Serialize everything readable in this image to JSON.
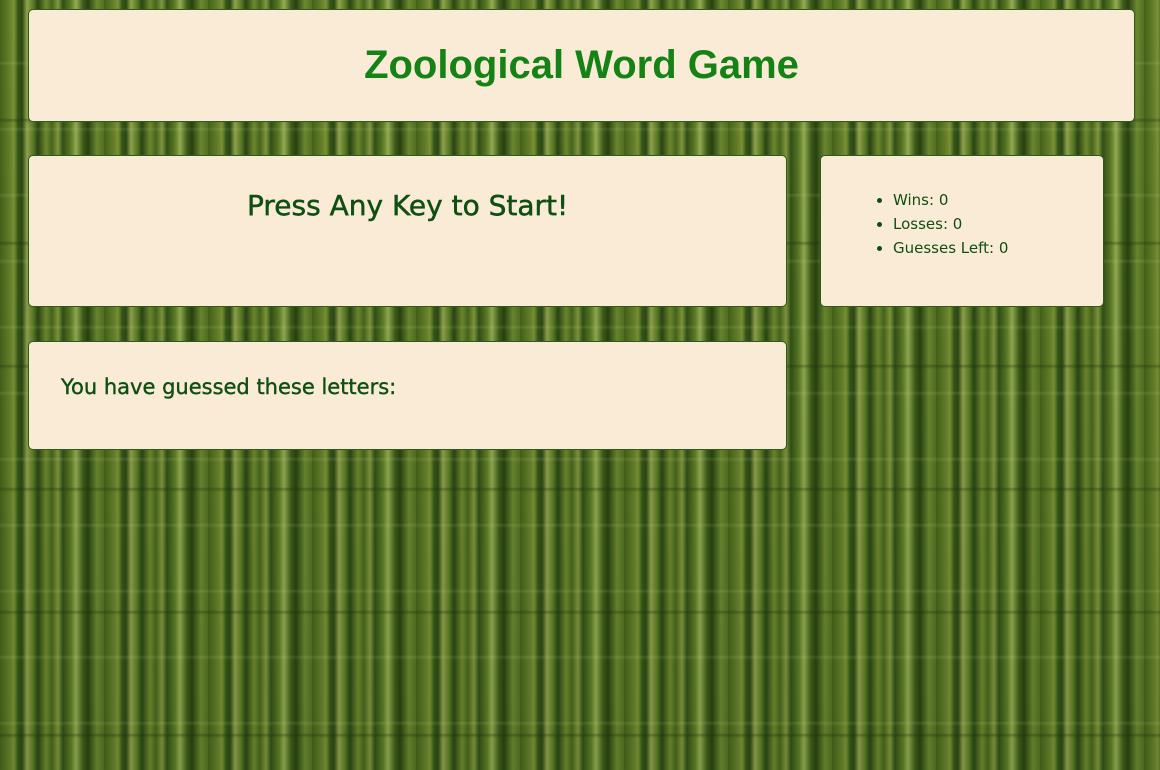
{
  "header": {
    "title": "Zoological Word Game"
  },
  "game": {
    "prompt": "Press Any Key to Start!"
  },
  "stats": {
    "wins_label": "Wins: ",
    "wins": "0",
    "losses_label": "Losses: ",
    "losses": "0",
    "guesses_left_label": "Guesses Left: ",
    "guesses_left": "0"
  },
  "guessed": {
    "label": "You have guessed these letters:",
    "letters": ""
  },
  "colors": {
    "panel_background": "#faebd7",
    "title_green": "#148214",
    "text_dark_green": "#0f4f12"
  }
}
